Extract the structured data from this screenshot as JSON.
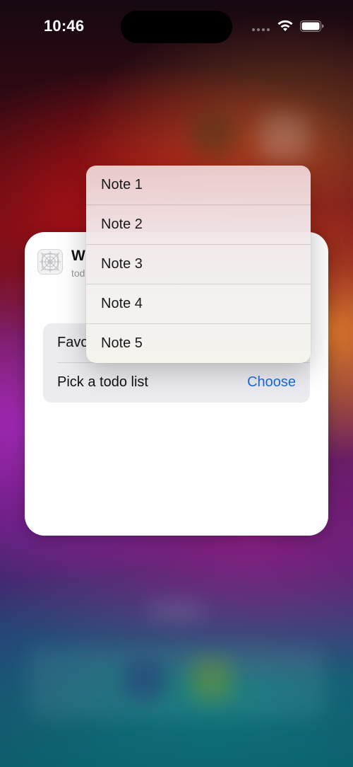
{
  "status_bar": {
    "time": "10:46"
  },
  "widget_config": {
    "title": "W",
    "subtitle": "tod",
    "rows": [
      {
        "label": "Favo",
        "value": ""
      },
      {
        "label": "Pick a todo list",
        "value": "Choose"
      }
    ]
  },
  "menu": {
    "items": [
      "Note 1",
      "Note 2",
      "Note 3",
      "Note 4",
      "Note 5"
    ]
  },
  "colors": {
    "accent": "#1a6fd8"
  }
}
